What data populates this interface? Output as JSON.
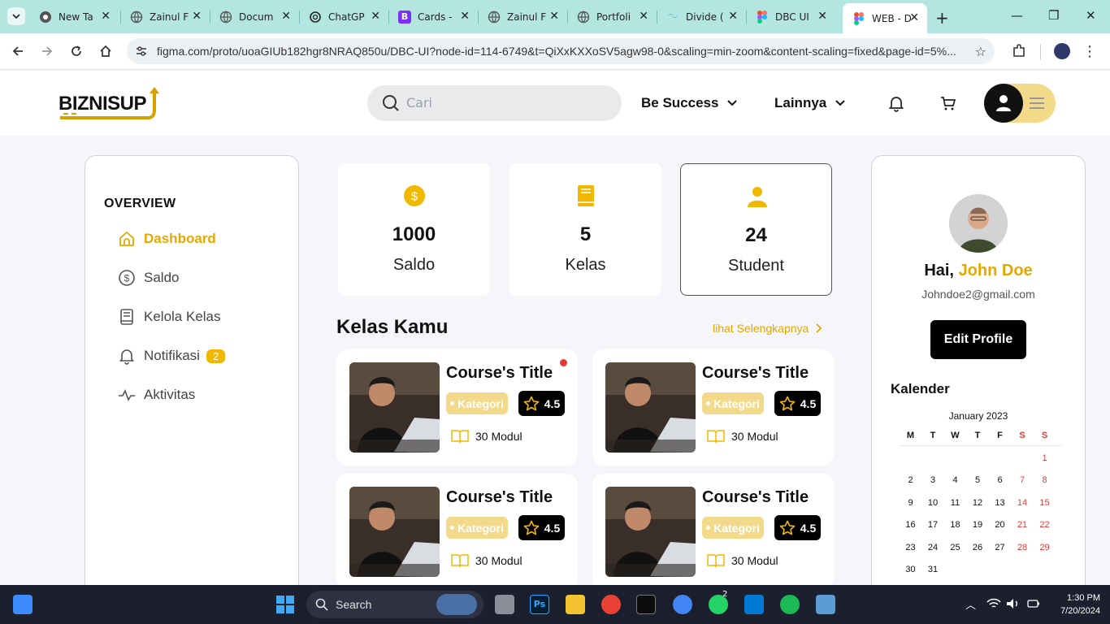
{
  "browser": {
    "tabs": [
      {
        "title": "New Ta",
        "favicon": "chrome-icon"
      },
      {
        "title": "Zainul F",
        "favicon": "globe-icon"
      },
      {
        "title": "Docum",
        "favicon": "globe-icon"
      },
      {
        "title": "ChatGP",
        "favicon": "openai-icon"
      },
      {
        "title": "Cards -",
        "favicon": "bootstrap-icon"
      },
      {
        "title": "Zainul F",
        "favicon": "globe-icon"
      },
      {
        "title": "Portfoli",
        "favicon": "globe-icon"
      },
      {
        "title": "Divide (",
        "favicon": "tailwind-icon"
      },
      {
        "title": "DBC UI",
        "favicon": "figma-icon"
      },
      {
        "title": "WEB - D",
        "favicon": "figma-icon",
        "active": true
      }
    ],
    "url": "figma.com/proto/uoaGIUb182hgr8NRAQ850u/DBC-UI?node-id=114-6749&t=QiXxKXXoSV5agw98-0&scaling=min-zoom&content-scaling=fixed&page-id=5%..."
  },
  "header": {
    "logo_text": "BIZNISUP",
    "search_placeholder": "Cari",
    "menu1": "Be Success",
    "menu2": "Lainnya"
  },
  "sidebar": {
    "title": "OVERVIEW",
    "items": [
      {
        "label": "Dashboard",
        "icon": "home-icon",
        "active": true
      },
      {
        "label": "Saldo",
        "icon": "dollar-circle-icon"
      },
      {
        "label": "Kelola Kelas",
        "icon": "book-icon"
      },
      {
        "label": "Notifikasi",
        "icon": "bell-icon",
        "badge": "2"
      },
      {
        "label": "Aktivitas",
        "icon": "activity-icon"
      }
    ]
  },
  "stats": [
    {
      "value": "1000",
      "label": "Saldo",
      "icon": "dollar-coin-icon"
    },
    {
      "value": "5",
      "label": "Kelas",
      "icon": "book-icon"
    },
    {
      "value": "24",
      "label": "Student",
      "icon": "person-icon"
    }
  ],
  "classes": {
    "title": "Kelas Kamu",
    "see_more": "lihat Selengkapnya",
    "cards": [
      {
        "title": "Course's Title",
        "category": "Kategori",
        "rating": "4.5",
        "modules": "30 Modul",
        "has_new": true
      },
      {
        "title": "Course's Title",
        "category": "Kategori",
        "rating": "4.5",
        "modules": "30 Modul"
      },
      {
        "title": "Course's Title",
        "category": "Kategori",
        "rating": "4.5",
        "modules": "30 Modul"
      },
      {
        "title": "Course's Title",
        "category": "Kategori",
        "rating": "4.5",
        "modules": "30 Modul"
      }
    ]
  },
  "profile": {
    "greeting": "Hai,",
    "name": "John Doe",
    "email": "Johndoe2@gmail.com",
    "edit_label": "Edit Profile",
    "calendar_title": "Kalender",
    "month": "January  2023",
    "weekdays": [
      "M",
      "T",
      "W",
      "T",
      "F",
      "S",
      "S"
    ],
    "weeks": [
      [
        "",
        "",
        "",
        "",
        "",
        "",
        "1"
      ],
      [
        "2",
        "3",
        "4",
        "5",
        "6",
        "7",
        "8"
      ],
      [
        "9",
        "10",
        "11",
        "12",
        "13",
        "14",
        "15"
      ],
      [
        "16",
        "17",
        "18",
        "19",
        "20",
        "21",
        "22"
      ],
      [
        "23",
        "24",
        "25",
        "26",
        "27",
        "28",
        "29"
      ],
      [
        "30",
        "31",
        "",
        "",
        "",
        "",
        ""
      ]
    ]
  },
  "taskbar": {
    "search_label": "Search",
    "time": "1:30 PM",
    "date": "7/20/2024",
    "whatsapp_badge": "2"
  },
  "colors": {
    "accent": "#e6a800",
    "accent_soft": "#f3d98a",
    "weekend": "#e53935"
  }
}
